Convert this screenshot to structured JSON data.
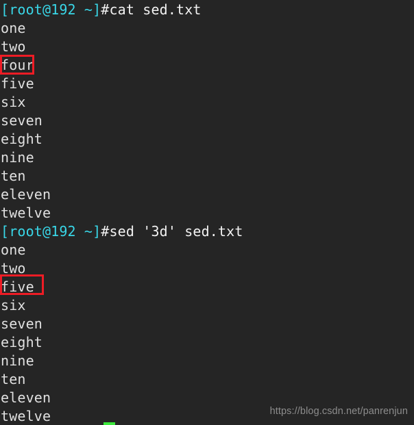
{
  "terminal": {
    "background_color": "#252525",
    "foreground_color": "#e8e8e8",
    "prompt_color": "#39d7e8",
    "highlight_color": "#ee1c25",
    "cursor_color": "#3ce83c",
    "prompt_text": "[root@192 ~]#",
    "blocks": [
      {
        "command": "cat sed.txt",
        "output": [
          "one",
          "two",
          "four",
          "five",
          "six",
          "seven",
          "eight",
          "nine",
          "ten",
          "eleven",
          "twelve"
        ]
      },
      {
        "command": "sed '3d' sed.txt",
        "output": [
          "one",
          "two",
          "five",
          "six",
          "seven",
          "eight",
          "nine",
          "ten",
          "eleven",
          "twelve"
        ]
      }
    ],
    "highlights": [
      {
        "label": "four",
        "note": "deleted-line-marker"
      },
      {
        "label": "five",
        "note": "shifted-line-marker"
      }
    ]
  },
  "watermark": {
    "text": "https://blog.csdn.net/panrenjun",
    "color": "#8d8d8d"
  }
}
